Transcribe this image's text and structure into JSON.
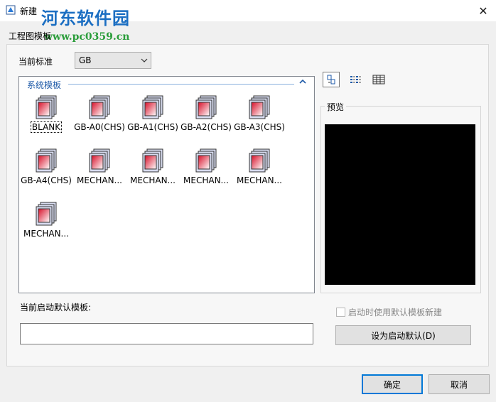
{
  "window": {
    "title": "新建",
    "close_glyph": "✕",
    "icon": "app-icon"
  },
  "watermark": {
    "text": "河东软件园",
    "url": "www.pc0359.cn",
    "color": "#1b6ec2",
    "url_color": "#2a9d3a"
  },
  "tab": {
    "label": "工程图模板"
  },
  "standard": {
    "label": "当前标准",
    "value": "GB"
  },
  "templates": {
    "group_title": "系统模板",
    "items": [
      {
        "name": "BLANK",
        "selected": true
      },
      {
        "name": "GB-A0(CHS)"
      },
      {
        "name": "GB-A1(CHS)"
      },
      {
        "name": "GB-A2(CHS)"
      },
      {
        "name": "GB-A3(CHS)"
      },
      {
        "name": "GB-A4(CHS)"
      },
      {
        "name": "MECHAN..."
      },
      {
        "name": "MECHAN..."
      },
      {
        "name": "MECHAN..."
      },
      {
        "name": "MECHAN..."
      },
      {
        "name": "MECHAN..."
      }
    ]
  },
  "view_modes": [
    "large-icons-view-icon",
    "list-view-icon",
    "details-view-icon"
  ],
  "preview": {
    "label": "预览",
    "background": "#000000"
  },
  "startup": {
    "label": "当前启动默认模板:",
    "value": "",
    "checkbox_label": "启动时使用默认模板新建",
    "set_default_button": "设为启动默认(D)"
  },
  "footer": {
    "ok": "确定",
    "cancel": "取消",
    "accent": "#0078d7"
  }
}
